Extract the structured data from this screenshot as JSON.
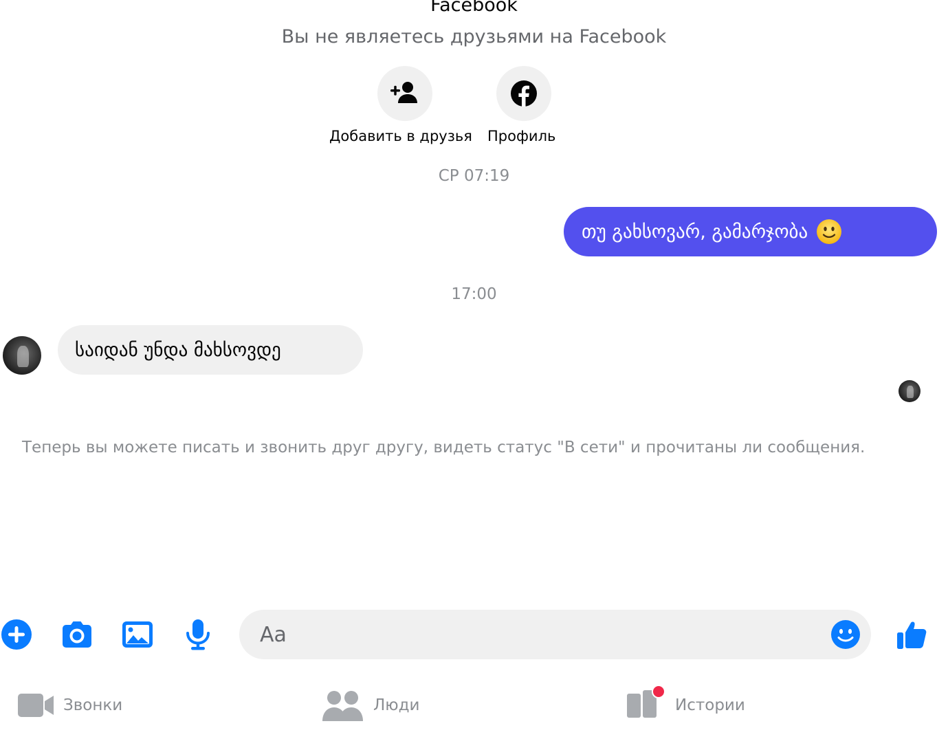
{
  "header": {
    "name": "Facebook",
    "subtitle": "Вы не являетесь друзьями на Facebook"
  },
  "actions": {
    "add_friend_label": "Добавить в друзья",
    "profile_label": "Профиль"
  },
  "conversation": {
    "timestamp_1": "СР 07:19",
    "outgoing_message": "თუ გახსოვარ, გამარჯობა",
    "timestamp_2": "17:00",
    "incoming_message": "საიდან უნდა მახსოვდე",
    "notice": "Теперь вы можете писать и звонить друг другу, видеть статус \"В сети\" и прочитаны ли сообщения."
  },
  "composer": {
    "placeholder": "Aa"
  },
  "bottom_nav": {
    "calls": "Звонки",
    "people": "Люди",
    "stories": "Истории"
  },
  "colors": {
    "accent": "#0a7cff",
    "outgoing_bubble": "#5350ee",
    "incoming_bubble": "#f0f0f0",
    "badge": "#f02849"
  },
  "icons": {
    "tools": [
      "plus-icon",
      "camera-icon",
      "image-icon",
      "microphone-icon"
    ],
    "composer": "emoji-icon",
    "send": "thumbs-up-icon",
    "nav": [
      "video-camera-icon",
      "people-icon",
      "stories-icon"
    ]
  }
}
